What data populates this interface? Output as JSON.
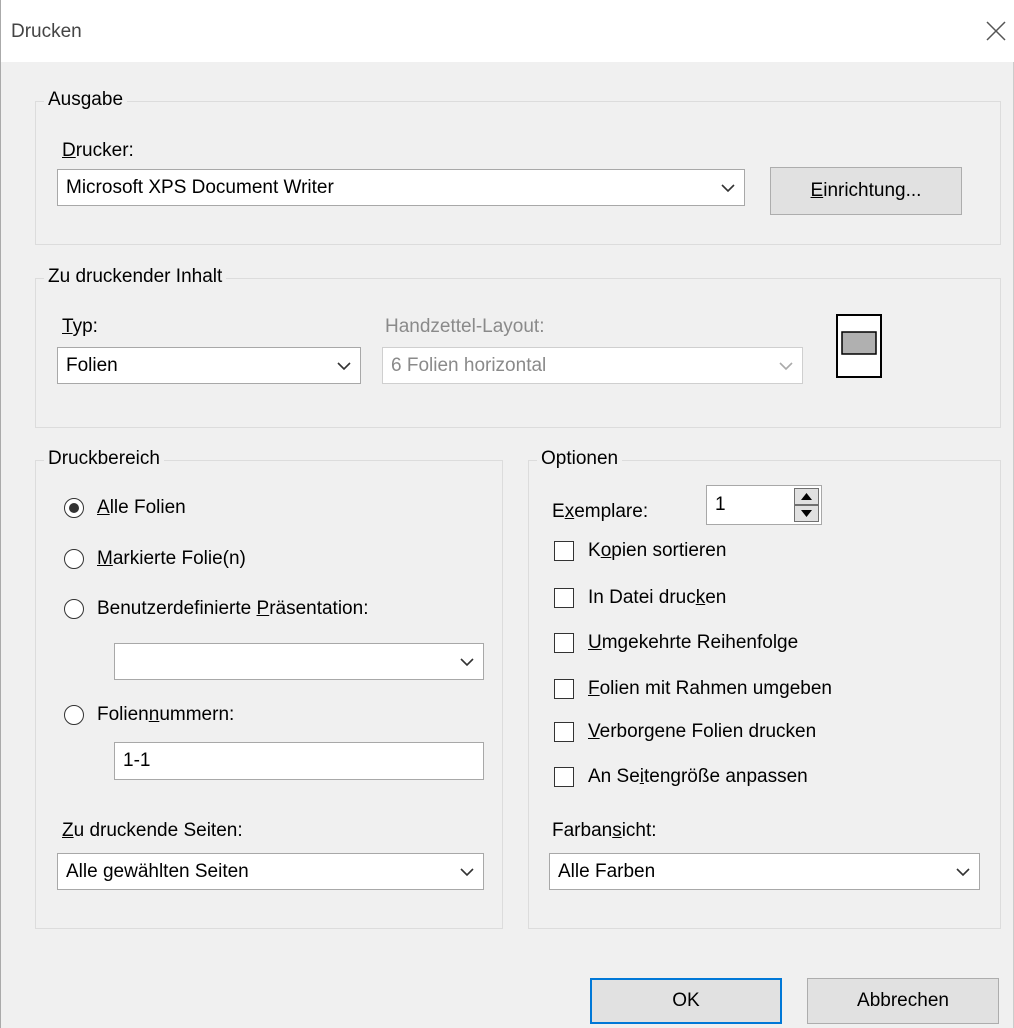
{
  "window": {
    "title": "Drucken"
  },
  "ausgabe": {
    "legend": "Ausgabe",
    "drucker_label_u": "D",
    "drucker_label_rest": "rucker:",
    "drucker_value": "Microsoft XPS Document Writer",
    "einrichtung_u": "E",
    "einrichtung_rest": "inrichtung..."
  },
  "inhalt": {
    "legend": "Zu druckender Inhalt",
    "typ_label_u": "T",
    "typ_label_rest": "yp:",
    "typ_value": "Folien",
    "handzettel_label": "Handzettel-Layout:",
    "handzettel_value": "6 Folien horizontal"
  },
  "druckbereich": {
    "legend": "Druckbereich",
    "alle_u": "A",
    "alle_rest": "lle Folien",
    "markierte_u": "M",
    "markierte_rest": "arkierte Folie(n)",
    "benutzer_pre": "Benutzerdefinierte ",
    "benutzer_u": "P",
    "benutzer_rest": "räsentation:",
    "benutzer_value": "",
    "foliennr_pre": "Folien",
    "foliennr_u": "n",
    "foliennr_rest": "ummern:",
    "foliennr_value": "1-1",
    "seiten_label_u": "Z",
    "seiten_label_rest": "u druckende Seiten:",
    "seiten_value": "Alle gewählten Seiten"
  },
  "optionen": {
    "legend": "Optionen",
    "exemplare_pre": "E",
    "exemplare_u": "x",
    "exemplare_rest": "emplare:",
    "exemplare_value": "1",
    "kopien_pre": "K",
    "kopien_u": "o",
    "kopien_rest": "pien sortieren",
    "datei_pre": "In Datei druc",
    "datei_u": "k",
    "datei_rest": "en",
    "umgekehrt_u": "U",
    "umgekehrt_rest": "mgekehrte Reihenfolge",
    "rahmen_u": "F",
    "rahmen_rest": "olien mit Rahmen umgeben",
    "verborgen_u": "V",
    "verborgen_rest": "erborgene Folien drucken",
    "anpassen_pre": "An Se",
    "anpassen_u": "i",
    "anpassen_rest": "tengröße anpassen",
    "farb_pre": "Farban",
    "farb_u": "s",
    "farb_rest": "icht:",
    "farb_value": "Alle Farben"
  },
  "buttons": {
    "ok": "OK",
    "abbrechen": "Abbrechen"
  }
}
